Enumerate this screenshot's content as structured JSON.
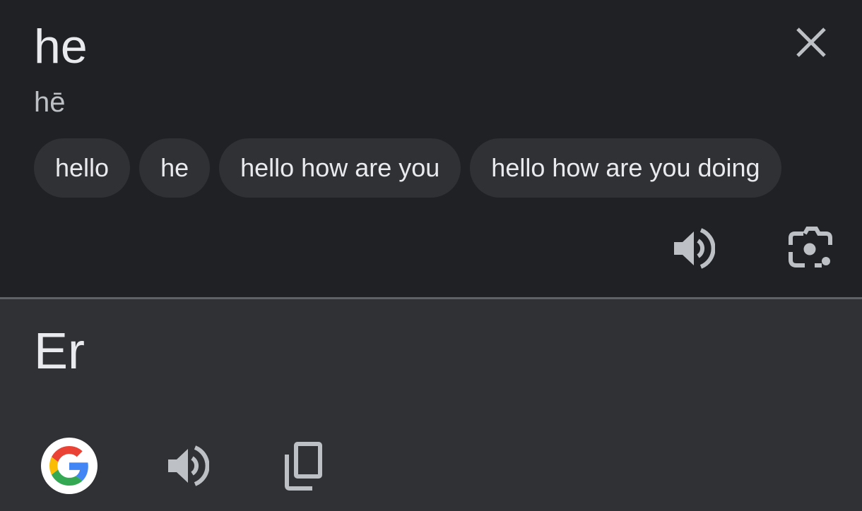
{
  "source": {
    "text": "he",
    "romanization": "hē",
    "suggestions": [
      "hello",
      "he",
      "hello how are you",
      "hello how are you doing"
    ],
    "icons": {
      "close": "close-icon",
      "speaker": "speaker-icon",
      "camera": "lens-camera-icon"
    }
  },
  "target": {
    "text": "Er",
    "icons": {
      "google": "google-logo-icon",
      "speaker": "speaker-icon",
      "copy": "copy-icon"
    }
  },
  "colors": {
    "source_bg": "#202124",
    "target_bg": "#303134",
    "divider": "#5f6368",
    "text_primary": "#e8eaed",
    "text_secondary": "#bdc1c6",
    "icon": "#bdc1c6",
    "chip_bg": "#303134"
  }
}
